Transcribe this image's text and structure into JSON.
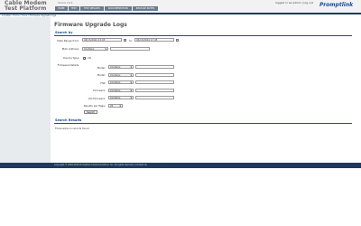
{
  "header": {
    "brand_line1": "Cable Modem",
    "brand_line2": "Test Platform",
    "version": "Version 2.6.9",
    "login": "logged in as admin | log out",
    "logo": "Promptlink",
    "nav": [
      "HOME",
      "TEST",
      "TEST RESULTS",
      "DOCUMENTATION",
      "RELEASE NOTES"
    ]
  },
  "breadcrumb": {
    "prefix": "Location:",
    "home": "Home",
    "tools": "Tools",
    "current": "Firmware Upgrade Logs"
  },
  "page": {
    "title": "Firmware Upgrade Logs"
  },
  "search": {
    "title": "Search by",
    "date_label": "Date Range from:",
    "date_from": "04/15/2024 13:03",
    "date_to_label": "to:",
    "date_to": "04/15/2024 17:45",
    "mac_label": "MAC Address:",
    "mac_op": "Contains",
    "mac_value": "",
    "device_type_label": "Device Type:",
    "device_type_checked": true,
    "device_type_option": "Cbl",
    "details_label": "Firmware Details:",
    "fields": [
      {
        "label": "Model:",
        "op": "Contains"
      },
      {
        "label": "Model:",
        "op": "Contains"
      },
      {
        "label": "HW:",
        "op": "Contains"
      },
      {
        "label": "Firmware:",
        "op": "Contains"
      },
      {
        "label": "Old Firmware:",
        "op": "Contains"
      }
    ],
    "results_per_page_label": "Results per Page:",
    "results_per_page": "25",
    "submit": "Search"
  },
  "results": {
    "title": "Search Results",
    "message": "There were no records found."
  },
  "footer": {
    "text": "Copyright © 2004-2024 Promptlink Communications, Inc. All rights reserved | Contact Us"
  }
}
